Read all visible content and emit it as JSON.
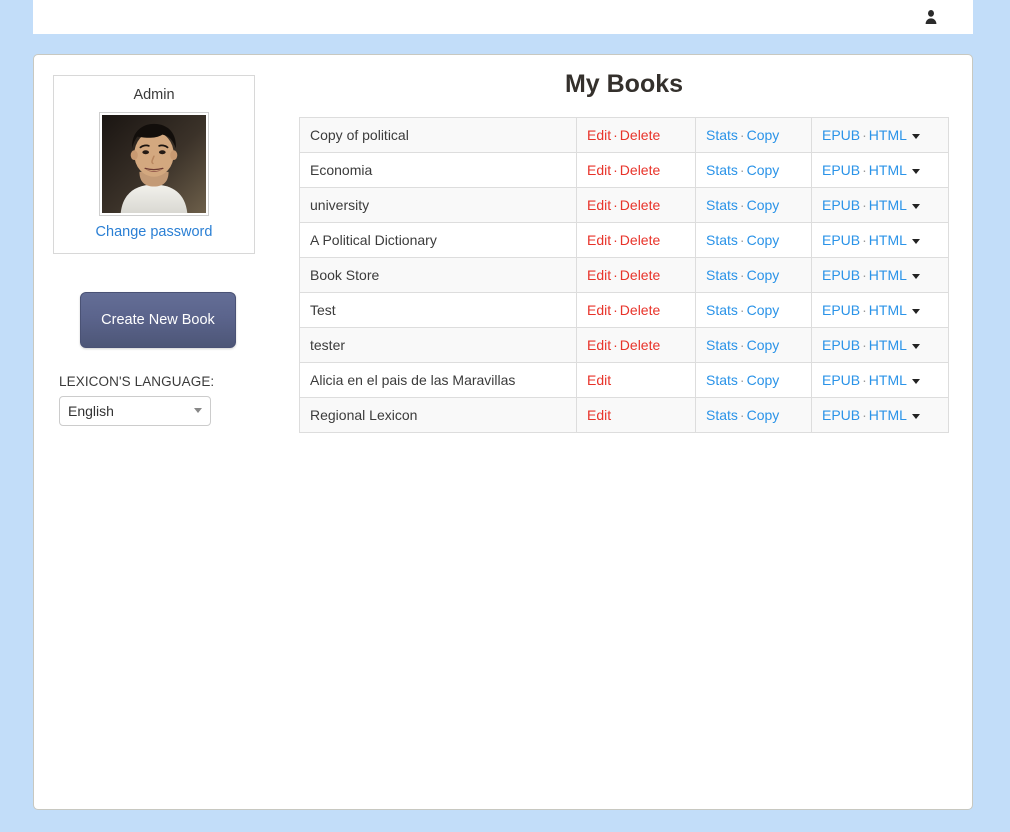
{
  "topbar": {
    "user_icon": "user-silhouette-icon"
  },
  "sidebar": {
    "profile": {
      "name": "Admin",
      "avatar_icon": "user-photo-avatar",
      "change_password_label": "Change password"
    },
    "create_button_label": "Create New Book",
    "language": {
      "label": "LEXICON'S LANGUAGE:",
      "selected": "English",
      "options": [
        "English"
      ]
    }
  },
  "main": {
    "title": "My Books",
    "actions": {
      "edit": "Edit",
      "delete": "Delete",
      "stats": "Stats",
      "copy": "Copy",
      "epub": "EPUB",
      "html": "HTML",
      "separator": "·"
    },
    "books": [
      {
        "title": "Copy of political",
        "edit": "Edit",
        "delete": "Delete",
        "stats": "Stats",
        "copy": "Copy",
        "epub": "EPUB",
        "html": "HTML"
      },
      {
        "title": "Economia",
        "edit": "Edit",
        "delete": "Delete",
        "stats": "Stats",
        "copy": "Copy",
        "epub": "EPUB",
        "html": "HTML"
      },
      {
        "title": "university",
        "edit": "Edit",
        "delete": "Delete",
        "stats": "Stats",
        "copy": "Copy",
        "epub": "EPUB",
        "html": "HTML"
      },
      {
        "title": "A Political Dictionary",
        "edit": "Edit",
        "delete": "Delete",
        "stats": "Stats",
        "copy": "Copy",
        "epub": "EPUB",
        "html": "HTML"
      },
      {
        "title": "Book Store",
        "edit": "Edit",
        "delete": "Delete",
        "stats": "Stats",
        "copy": "Copy",
        "epub": "EPUB",
        "html": "HTML"
      },
      {
        "title": "Test",
        "edit": "Edit",
        "delete": "Delete",
        "stats": "Stats",
        "copy": "Copy",
        "epub": "EPUB",
        "html": "HTML"
      },
      {
        "title": "tester",
        "edit": "Edit",
        "delete": "Delete",
        "stats": "Stats",
        "copy": "Copy",
        "epub": "EPUB",
        "html": "HTML"
      },
      {
        "title": "Alicia en el pais de las Maravillas",
        "edit": "Edit",
        "delete": null,
        "stats": "Stats",
        "copy": "Copy",
        "epub": "EPUB",
        "html": "HTML"
      },
      {
        "title": "Regional Lexicon",
        "edit": "Edit",
        "delete": null,
        "stats": "Stats",
        "copy": "Copy",
        "epub": "EPUB",
        "html": "HTML"
      }
    ]
  },
  "colors": {
    "page_background": "#c2ddf9",
    "card_background": "#ffffff",
    "row_stripe": "#f9f9f9",
    "link_red": "#e8332a",
    "link_blue": "#2a93e8",
    "button_gradient_top": "#646e96",
    "button_gradient_bottom": "#4d5677"
  }
}
